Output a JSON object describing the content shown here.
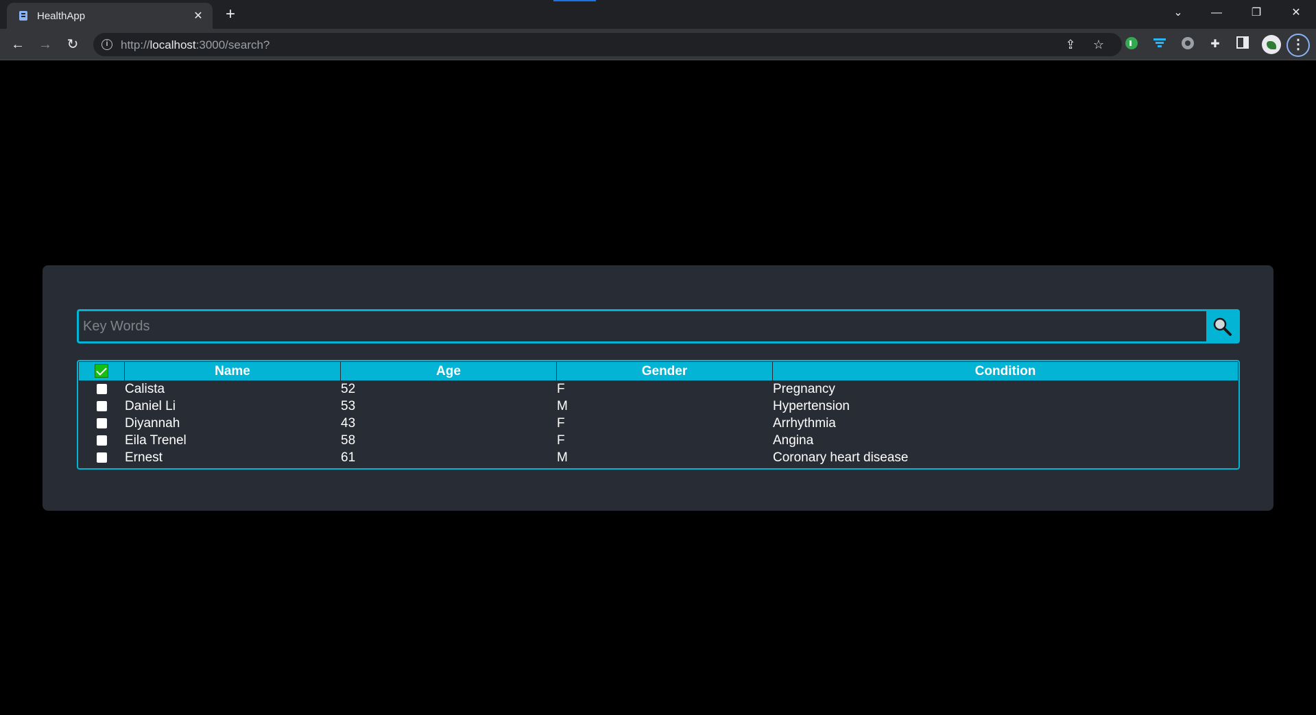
{
  "browser": {
    "tab_title": "HealthApp",
    "url_prefix": "http://",
    "url_host": "localhost",
    "url_rest": ":3000/search?"
  },
  "search": {
    "placeholder": "Key Words",
    "value": ""
  },
  "table": {
    "select_all_checked": true,
    "columns": [
      "Name",
      "Age",
      "Gender",
      "Condition"
    ],
    "rows": [
      {
        "checked": false,
        "name": "Calista",
        "age": "52",
        "gender": "F",
        "condition": "Pregnancy"
      },
      {
        "checked": false,
        "name": "Daniel Li",
        "age": "53",
        "gender": "M",
        "condition": "Hypertension"
      },
      {
        "checked": false,
        "name": "Diyannah",
        "age": "43",
        "gender": "F",
        "condition": "Arrhythmia"
      },
      {
        "checked": false,
        "name": "Eila Trenel",
        "age": "58",
        "gender": "F",
        "condition": "Angina"
      },
      {
        "checked": false,
        "name": "Ernest",
        "age": "61",
        "gender": "M",
        "condition": "Coronary heart disease"
      }
    ]
  },
  "colors": {
    "accent": "#04b4d4",
    "panel": "#282c34",
    "background": "#000000",
    "check_green": "#13c013"
  }
}
